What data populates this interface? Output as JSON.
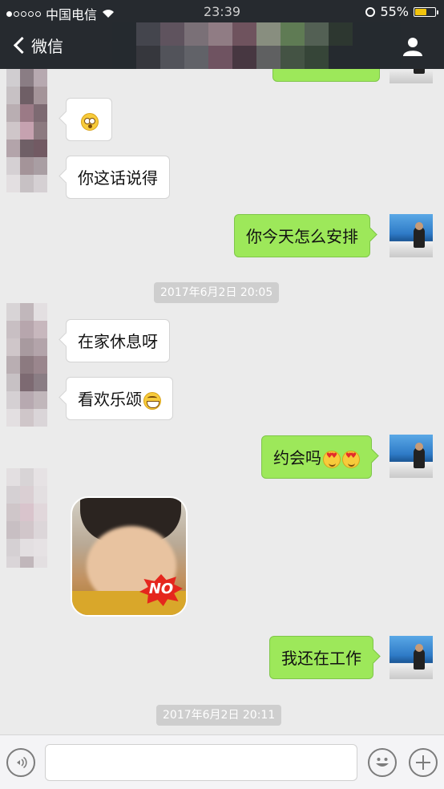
{
  "status_bar": {
    "carrier": "中国电信",
    "time": "23:39",
    "battery_text": "55%",
    "signal_filled": 1,
    "signal_total": 5,
    "battery_level": 0.55
  },
  "nav": {
    "back_label": "微信",
    "profile_icon": "person-icon"
  },
  "messages": [
    {
      "side": "in",
      "text": "",
      "emoji": "surprised"
    },
    {
      "side": "in",
      "text": "你这话说得"
    },
    {
      "side": "out",
      "text": "你今天怎么安排"
    },
    {
      "side": "in",
      "text": "在家休息呀"
    },
    {
      "side": "in",
      "text": "看欢乐颂",
      "emoji": "grin"
    },
    {
      "side": "out",
      "text": "约会吗",
      "emoji": "heart-eyes x2"
    },
    {
      "side": "in",
      "sticker": "NO"
    },
    {
      "side": "out",
      "text": "我还在工作"
    }
  ],
  "timestamps": [
    "2017年6月2日 20:05",
    "2017年6月2日 20:11"
  ],
  "sticker": {
    "text": "NO"
  },
  "input_bar": {
    "placeholder": "",
    "icons": [
      "voice-icon",
      "emoji-icon",
      "plus-icon"
    ]
  },
  "colors": {
    "nav_bg": "#262a2f",
    "chat_bg": "#ebebeb",
    "out_bubble": "#9de85a",
    "in_bubble": "#ffffff",
    "timestamp_bg": "#cecece",
    "battery": "#f2c40d"
  }
}
